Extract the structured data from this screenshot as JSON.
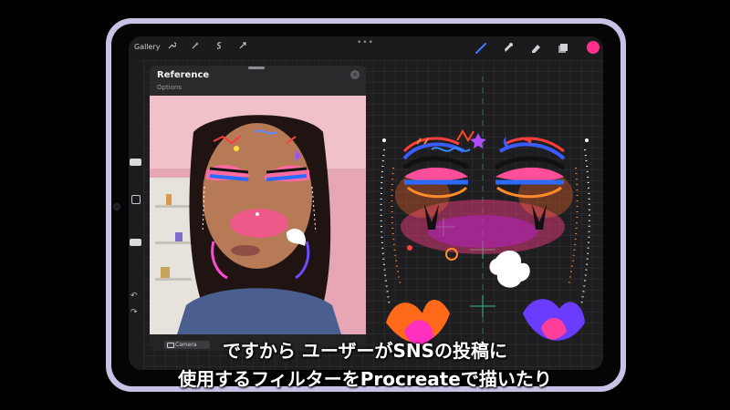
{
  "toolbar": {
    "gallery_label": "Gallery",
    "left_tools": [
      "wrench-icon",
      "magic-wand-icon",
      "selection-icon",
      "transform-icon"
    ],
    "right_tools": [
      "brush-icon",
      "smudge-icon",
      "eraser-icon",
      "layers-icon"
    ],
    "brush_active_color": "#3a7bff",
    "current_color": "#ff2f8c"
  },
  "reference": {
    "title": "Reference",
    "options_label": "Options",
    "camera_label": "Camera"
  },
  "subtitles": {
    "line1": "ですから ユーザーがSNSの投稿に",
    "line2": "使用するフィルターをProcreateで描いたり"
  }
}
